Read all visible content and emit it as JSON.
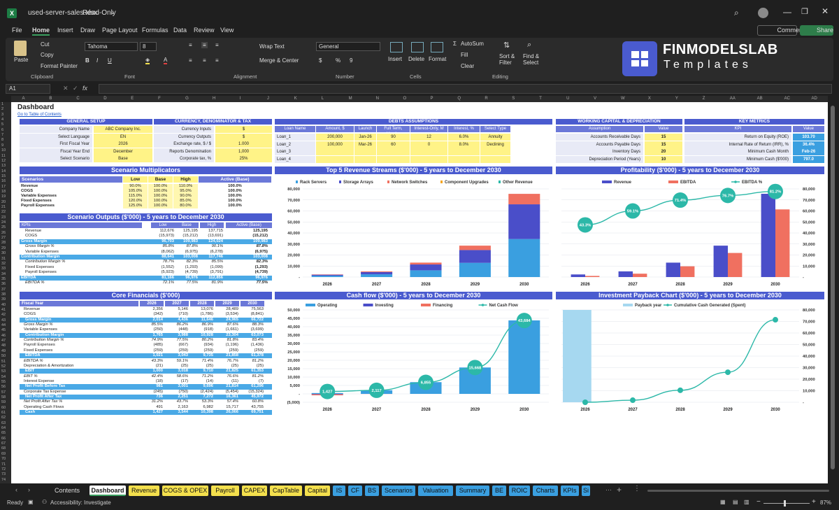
{
  "window": {
    "filename": "used-server-sales.xlsx",
    "mode": "Read-Only"
  },
  "menu": [
    "File",
    "Home",
    "Insert",
    "Draw",
    "Page Layout",
    "Formulas",
    "Data",
    "Review",
    "View"
  ],
  "menu_right": {
    "comments": "Comments",
    "share": "Share"
  },
  "ribbon": {
    "paste": "Paste",
    "cut": "Cut",
    "copy": "Copy",
    "format_painter": "Format Painter",
    "clipboard": "Clipboard",
    "font_name": "Tahoma",
    "font_size": "8",
    "font_group": "Font",
    "wrap_text": "Wrap Text",
    "merge_center": "Merge & Center",
    "alignment": "Alignment",
    "number_format": "General",
    "number": "Number",
    "insert": "Insert",
    "delete": "Delete",
    "format": "Format",
    "cells": "Cells",
    "autosum": "AutoSum",
    "fill": "Fill",
    "clear": "Clear",
    "sort_filter": "Sort & Filter",
    "find_select": "Find & Select",
    "editing": "Editing"
  },
  "logo": {
    "line1": "FINMODELSLAB",
    "line2": "Templates"
  },
  "formula_bar": {
    "name_box": "A1",
    "fx": "fx"
  },
  "columns": [
    "A",
    "B",
    "C",
    "D",
    "E",
    "F",
    "G",
    "H",
    "I",
    "J",
    "K",
    "L",
    "M",
    "N",
    "O",
    "P",
    "Q",
    "R",
    "S",
    "T",
    "U",
    "V",
    "W",
    "X",
    "Y",
    "Z",
    "AA",
    "AB",
    "AC",
    "AD"
  ],
  "dashboard": {
    "title": "Dashboard",
    "link": "Go to Table of Contents",
    "general_setup": {
      "title": "GENERAL SETUP",
      "rows": [
        [
          "Company Name",
          "ABC Company Inc."
        ],
        [
          "Select Language",
          "EN"
        ],
        [
          "First Fiscal Year",
          "2026"
        ],
        [
          "Fiscal Year End",
          "December"
        ],
        [
          "Select Scenario",
          "Base"
        ]
      ]
    },
    "currency": {
      "title": "CURRENCY, DENOMINATOR & TAX",
      "rows": [
        [
          "Currency Inputs",
          "$"
        ],
        [
          "Currency Outputs",
          "$"
        ],
        [
          "Exchange rate, $ / $",
          "1.000"
        ],
        [
          "Reports Denomination",
          "1,000"
        ],
        [
          "Corporate tax, %",
          "25%"
        ]
      ]
    },
    "debts": {
      "title": "DEBTS ASSUMPTIONS",
      "headers": [
        "Loan Name",
        "Amount, $",
        "Launch",
        "Full Term, Months",
        "Interest-Only, M",
        "Interest, %",
        "Select Type"
      ],
      "rows": [
        [
          "Loan_1",
          "200,000",
          "Jan-26",
          "90",
          "12",
          "6.0%",
          "Annuity"
        ],
        [
          "Loan_2",
          "100,000",
          "Mar-26",
          "60",
          "0",
          "8.0%",
          "Declining Balance"
        ],
        [
          "Loan_3",
          "",
          "",
          "",
          "",
          "",
          ""
        ],
        [
          "Loan_4",
          "",
          "",
          "",
          "",
          "",
          ""
        ]
      ]
    },
    "working_capital": {
      "title": "WORKING CAPITAL & DEPRECIATION",
      "headers": [
        "Assumption",
        "Value"
      ],
      "rows": [
        [
          "Accounts Receivable Days",
          "15"
        ],
        [
          "Accounts Payable Days",
          "15"
        ],
        [
          "Inventory Days",
          "20"
        ],
        [
          "Depreciation Period (Years)",
          "10"
        ]
      ]
    },
    "key_metrics": {
      "title": "KEY METRICS",
      "headers": [
        "KPI",
        "Value"
      ],
      "rows": [
        [
          "Return on Equity (ROE)",
          "103.70"
        ],
        [
          "Internal Rate of Return (IRR), %",
          "36.4%"
        ],
        [
          "Minimum Cash Month",
          "Feb-26"
        ],
        [
          "Minimum Cash ($'000)",
          "797.0"
        ]
      ]
    },
    "scenario_multipliers": {
      "title": "Scenario Multiplicators",
      "headers": [
        "Scenarios",
        "Low",
        "Base",
        "High",
        "Active (Base)"
      ],
      "rows": [
        [
          "Revenue",
          "90.0%",
          "100.0%",
          "110.0%",
          "100.0%"
        ],
        [
          "COGS",
          "105.0%",
          "100.0%",
          "95.0%",
          "100.0%"
        ],
        [
          "Variable Expenses",
          "115.0%",
          "100.0%",
          "90.0%",
          "100.0%"
        ],
        [
          "Fixed Expenses",
          "120.0%",
          "100.0%",
          "85.0%",
          "100.0%"
        ],
        [
          "Payroll Expenses",
          "125.0%",
          "100.0%",
          "80.0%",
          "100.0%"
        ]
      ]
    },
    "scenario_outputs": {
      "title": "Scenario Outputs ($'000) - 5 years to December 2030",
      "headers": [
        "KPIs",
        "Low",
        "Base",
        "High",
        "Active (Base)"
      ],
      "rows": [
        [
          "Revenue",
          "112,676",
          "125,195",
          "137,715",
          "125,195"
        ],
        [
          "COGS",
          "(15,973)",
          "(15,212)",
          "(13,691)",
          "(15,212)"
        ],
        [
          "Gross Margin",
          "96,703",
          "109,983",
          "124,024",
          "109,983"
        ],
        [
          "Gross Margin %",
          "85.8%",
          "87.8%",
          "90.1%",
          "87.8%"
        ],
        [
          "Variable Expenses",
          "(8,062)",
          "(6,975)",
          "(6,278)",
          "(6,975)"
        ],
        [
          "Contribution Margin",
          "88,641",
          "103,008",
          "117,746",
          "103,008"
        ],
        [
          "Contribution Margin %",
          "78.7%",
          "82.3%",
          "85.5%",
          "82.3%"
        ],
        [
          "Fixed Expenses",
          "(1,552)",
          "(1,293)",
          "(1,099)",
          "(1,293)"
        ],
        [
          "Payroll Expenses",
          "(5,923)",
          "(4,739)",
          "(3,791)",
          "(4,739)"
        ],
        [
          "EBITDA",
          "81,166",
          "96,976",
          "112,856",
          "96,976"
        ],
        [
          "EBITDA %",
          "72.1%",
          "77.5%",
          "81.9%",
          "77.5%"
        ]
      ]
    },
    "core_financials": {
      "title": "Core Financials ($'000)",
      "headers": [
        "Fiscal Year",
        "2026",
        "2027",
        "2028",
        "2029",
        "2030"
      ],
      "rows": [
        [
          "Revenue",
          "2,356",
          "5,146",
          "13,076",
          "28,489",
          "75,563"
        ],
        [
          "COGS",
          "(342)",
          "(710)",
          "(1,786)",
          "(3,534)",
          "(8,841)"
        ],
        [
          "Gross Margin",
          "2,014",
          "4,436",
          "11,646",
          "24,965",
          "66,722"
        ],
        [
          "Gross Margin %",
          "85.5%",
          "86.2%",
          "86.9%",
          "87.6%",
          "88.3%"
        ],
        [
          "Variable Expenses",
          "(250)",
          "(448)",
          "(918)",
          "(1,661)",
          "(3,699)"
        ],
        [
          "Contribution Margin",
          "1,765",
          "3,988",
          "10,928",
          "23,304",
          "63,073"
        ],
        [
          "Contribution Margin %",
          "74.9%",
          "77.5%",
          "80.2%",
          "81.8%",
          "83.4%"
        ],
        [
          "Payroll Expenses",
          "(485)",
          "(667)",
          "(934)",
          "(1,196)",
          "(1,436)"
        ],
        [
          "Fixed Expenses",
          "(259)",
          "(259)",
          "(259)",
          "(259)",
          "(259)"
        ],
        [
          "EBITDA",
          "1,021",
          "3,043",
          "9,735",
          "21,858",
          "61,378"
        ],
        [
          "EBITDA %",
          "43.3%",
          "59.1%",
          "71.4%",
          "76.7%",
          "81.2%"
        ],
        [
          "Depreciation & Amortization",
          "(21)",
          "(25)",
          "(25)",
          "(25)",
          "(25)"
        ],
        [
          "EBIT",
          "1,000",
          "3,018",
          "9,710",
          "21,825",
          "61,353"
        ],
        [
          "EBIT %",
          "42.4%",
          "58.6%",
          "71.2%",
          "76.6%",
          "81.2%"
        ],
        [
          "Interest Expense",
          "(18)",
          "(17)",
          "(14)",
          "(11)",
          "(7)"
        ],
        [
          "Net Profit Before Tax",
          "981",
          "3,001",
          "9,696",
          "21,814",
          "61,296"
        ],
        [
          "Corporate Tax Expense",
          "(245)",
          "(750)",
          "(2,424)",
          "(5,454)",
          "(15,324)"
        ],
        [
          "Net Profit After Tax",
          "736",
          "2,251",
          "7,272",
          "16,361",
          "45,972"
        ],
        [
          "Net Profit After Tax %",
          "31.2%",
          "43.7%",
          "53.3%",
          "57.4%",
          "60.8%"
        ],
        [
          "Operating Cash Flows",
          "491",
          "2,163",
          "6,982",
          "15,717",
          "43,755"
        ],
        [
          "Cash",
          "1,427",
          "3,544",
          "10,398",
          "26,066",
          "69,751"
        ]
      ]
    }
  },
  "chart_data": [
    {
      "type": "bar",
      "title": "Top 5 Revenue Streams ($'000) - 5 years to December 2030",
      "categories": [
        "2026",
        "2027",
        "2028",
        "2029",
        "2030"
      ],
      "series": [
        {
          "name": "Rack Servers",
          "color": "#3a9fe0",
          "values": [
            1200,
            2500,
            6100,
            12900,
            34500
          ]
        },
        {
          "name": "Storage Arrays",
          "color": "#4a4ec9",
          "values": [
            900,
            2000,
            5300,
            11600,
            31500
          ]
        },
        {
          "name": "Network Switches",
          "color": "#f07060",
          "values": [
            300,
            650,
            1700,
            4000,
            9500
          ]
        },
        {
          "name": "Component Upgrades",
          "color": "#f5a623",
          "values": [
            0,
            0,
            0,
            0,
            0
          ]
        },
        {
          "name": "Other Revenue",
          "color": "#2cb8a8",
          "values": [
            0,
            0,
            0,
            0,
            0
          ]
        }
      ],
      "ylim": [
        0,
        80000
      ],
      "yticks": [
        "-",
        "10,000",
        "20,000",
        "30,000",
        "40,000",
        "50,000",
        "60,000",
        "70,000",
        "80,000"
      ]
    },
    {
      "type": "bar",
      "title": "Profitability ($'000) - 5 years to December 2030",
      "categories": [
        "2026",
        "2027",
        "2028",
        "2029",
        "2030"
      ],
      "series": [
        {
          "name": "Revenue",
          "color": "#4a4ec9",
          "values": [
            2356,
            5146,
            13076,
            28489,
            75563
          ]
        },
        {
          "name": "EBITDA",
          "color": "#f07060",
          "values": [
            1021,
            3043,
            9735,
            21858,
            61378
          ]
        },
        {
          "name": "EBITDA %",
          "color": "#2cb8a8",
          "values": [
            43.3,
            59.1,
            71.4,
            76.7,
            81.2
          ],
          "labels": [
            "43.3%",
            "59.1%",
            "71.4%",
            "76.7%",
            "81.2%"
          ]
        }
      ],
      "ylim": [
        0,
        80000
      ],
      "yticks": [
        "-",
        "10,000",
        "20,000",
        "30,000",
        "40,000",
        "50,000",
        "60,000",
        "70,000",
        "80,000"
      ]
    },
    {
      "type": "bar",
      "title": "Cash flow ($'000) - 5 years to December 2030",
      "categories": [
        "2026",
        "2027",
        "2028",
        "2029",
        "2030"
      ],
      "series": [
        {
          "name": "Operating",
          "color": "#3a9fe0",
          "values": [
            491,
            2163,
            6982,
            15717,
            43755
          ]
        },
        {
          "name": "Investing",
          "color": "#4a4ec9",
          "values": [
            -250,
            0,
            0,
            0,
            0
          ]
        },
        {
          "name": "Financing",
          "color": "#f07060",
          "values": [
            -600,
            -50,
            0,
            0,
            0
          ]
        },
        {
          "name": "Net Cash Flow",
          "color": "#2cb8a8",
          "values": [
            1427,
            2117,
            6855,
            15668,
            43684
          ],
          "labels": [
            "1,427",
            "2,117",
            "6,855",
            "15,668",
            "43,684"
          ]
        }
      ],
      "ylim": [
        -5000,
        50000
      ],
      "yticks": [
        "(5,000)",
        "-",
        "5,000",
        "10,000",
        "15,000",
        "20,000",
        "25,000",
        "30,000",
        "35,000",
        "40,000",
        "45,000",
        "50,000"
      ]
    },
    {
      "type": "line",
      "title": "Investment Payback Chart ($'000) - 5 years to December 2030",
      "categories": [
        "2026",
        "2027",
        "2028",
        "2029",
        "2030"
      ],
      "series": [
        {
          "name": "Payback year",
          "color": "#a6d8f0",
          "values": [
            80000,
            0,
            0,
            0,
            0
          ]
        },
        {
          "name": "Cumulative Cash Generated (Spent)",
          "color": "#2cb8a8",
          "values": [
            0,
            1800,
            10400,
            26000,
            71500
          ]
        }
      ],
      "ylim": [
        0,
        80000
      ],
      "yticks": [
        "-",
        "10,000",
        "20,000",
        "30,000",
        "40,000",
        "50,000",
        "60,000",
        "70,000",
        "80,000"
      ]
    }
  ],
  "sheet_tabs": [
    {
      "name": "Contents",
      "color": "#1f1f1f"
    },
    {
      "name": "Dashboard",
      "color": "#ffffff"
    },
    {
      "name": "Revenue",
      "color": "#f4e04d"
    },
    {
      "name": "COGS & OPEX",
      "color": "#f4e04d"
    },
    {
      "name": "Payroll",
      "color": "#f4e04d"
    },
    {
      "name": "CAPEX",
      "color": "#f4e04d"
    },
    {
      "name": "CapTable",
      "color": "#f4e04d"
    },
    {
      "name": "Capital",
      "color": "#f4e04d"
    },
    {
      "name": "IS",
      "color": "#3a9fe0"
    },
    {
      "name": "CF",
      "color": "#3a9fe0"
    },
    {
      "name": "BS",
      "color": "#3a9fe0"
    },
    {
      "name": "Scenarios",
      "color": "#3a9fe0"
    },
    {
      "name": "Valuation",
      "color": "#3a9fe0"
    },
    {
      "name": "Summary",
      "color": "#3a9fe0"
    },
    {
      "name": "BE",
      "color": "#3a9fe0"
    },
    {
      "name": "ROIC",
      "color": "#3a9fe0"
    },
    {
      "name": "Charts",
      "color": "#3a9fe0"
    },
    {
      "name": "KPIs",
      "color": "#3a9fe0"
    },
    {
      "name": "Si",
      "color": "#3a9fe0"
    }
  ],
  "status": {
    "ready": "Ready",
    "accessibility": "Accessibility: Investigate",
    "zoom": "87%"
  }
}
